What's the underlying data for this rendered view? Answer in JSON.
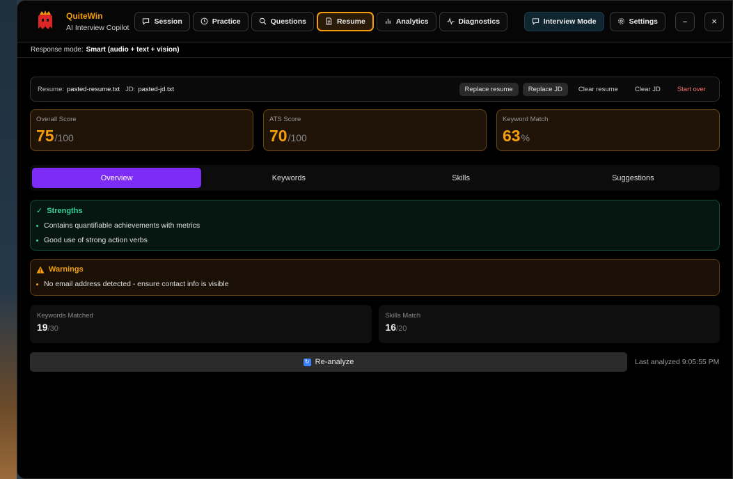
{
  "app": {
    "name": "QuiteWin",
    "subtitle": "AI Interview Copilot"
  },
  "nav": {
    "items": [
      {
        "label": "Session",
        "icon": "chat-icon"
      },
      {
        "label": "Practice",
        "icon": "clock-icon"
      },
      {
        "label": "Questions",
        "icon": "search-icon"
      },
      {
        "label": "Resume",
        "icon": "document-icon",
        "active": true
      },
      {
        "label": "Analytics",
        "icon": "bar-chart-icon"
      },
      {
        "label": "Diagnostics",
        "icon": "pulse-icon"
      }
    ],
    "interview_mode": "Interview Mode",
    "settings": "Settings",
    "minimize": "–",
    "close": "×"
  },
  "response_mode": {
    "label": "Response mode:",
    "value": "Smart (audio + text + vision)"
  },
  "files": {
    "resume_label": "Resume:",
    "resume_name": "pasted-resume.txt",
    "jd_label": "JD:",
    "jd_name": "pasted-jd.txt",
    "replace_resume": "Replace resume",
    "replace_jd": "Replace JD",
    "clear_resume": "Clear resume",
    "clear_jd": "Clear JD",
    "start_over": "Start over"
  },
  "scores": [
    {
      "label": "Overall Score",
      "value": "75",
      "suffix": "/100"
    },
    {
      "label": "ATS Score",
      "value": "70",
      "suffix": "/100"
    },
    {
      "label": "Keyword Match",
      "value": "63",
      "suffix": "%"
    }
  ],
  "tabs": [
    {
      "label": "Overview",
      "active": true
    },
    {
      "label": "Keywords"
    },
    {
      "label": "Skills"
    },
    {
      "label": "Suggestions"
    }
  ],
  "strengths": {
    "icon": "✓",
    "title": "Strengths",
    "items": [
      "Contains quantifiable achievements with metrics",
      "Good use of strong action verbs"
    ]
  },
  "warnings": {
    "title": "Warnings",
    "items": [
      "No email address detected - ensure contact info is visible"
    ]
  },
  "metrics": [
    {
      "label": "Keywords Matched",
      "value": "19",
      "total": "/30"
    },
    {
      "label": "Skills Match",
      "value": "16",
      "total": "/20"
    }
  ],
  "actions": {
    "reanalyze": "Re-analyze",
    "last_analyzed": "Last analyzed 9:05:55 PM"
  },
  "colors": {
    "accent": "#f59e0b",
    "tab_active": "#7c2cf5",
    "success": "#34d399",
    "danger": "#f87171"
  }
}
